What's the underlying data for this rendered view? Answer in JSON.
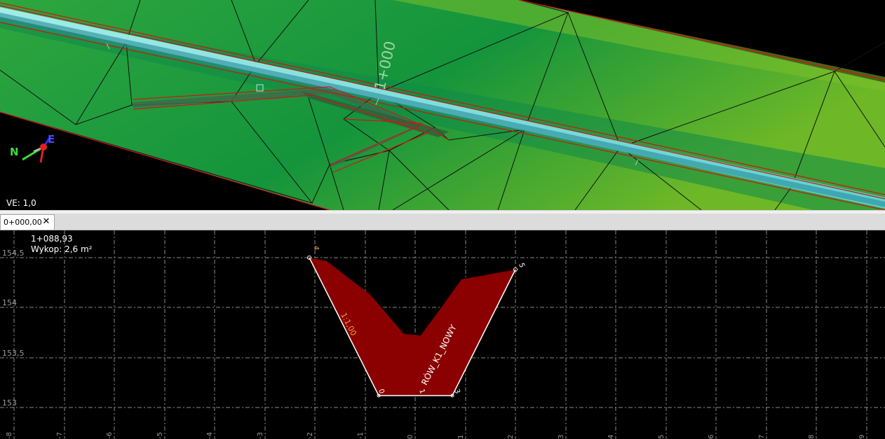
{
  "plan_view": {
    "station_label": "1+000",
    "vertical_exaggeration": "VE: 1,0",
    "compass": {
      "north": "N",
      "east": "E"
    },
    "colors": {
      "terrain": "#1f9e3a",
      "terrain_light": "#5cb82c",
      "ditch": "#7fe6e6",
      "breakline": "#d01515",
      "triangle_edge": "#0a0a0a",
      "station_text": "#9fd4a0"
    }
  },
  "tab": {
    "label": "0+000,00",
    "close_icon": "close-icon"
  },
  "section_view": {
    "station": "1+088,93",
    "cut_area": "Wykop: 2,6 m²",
    "alignment_label": "RÓW_K1_NOWY",
    "slope_label": "1:1,00",
    "y_axis_labels": [
      "154,5",
      "154",
      "153,5",
      "153"
    ],
    "x_axis_labels": [
      "-8",
      "-7",
      "-6",
      "-5",
      "-4",
      "-3",
      "-2",
      "-1",
      "0",
      "1",
      "2",
      "3",
      "4",
      "5",
      "6",
      "7",
      "8",
      "9"
    ],
    "point_labels": [
      "4",
      "5",
      "0",
      "1",
      "3"
    ],
    "colors": {
      "cut_fill": "#8b0000",
      "grid": "#9a9a9a",
      "design_line": "#ffffff",
      "point_label_orange": "#f0a040",
      "axis_text": "#9a9a9a"
    }
  }
}
